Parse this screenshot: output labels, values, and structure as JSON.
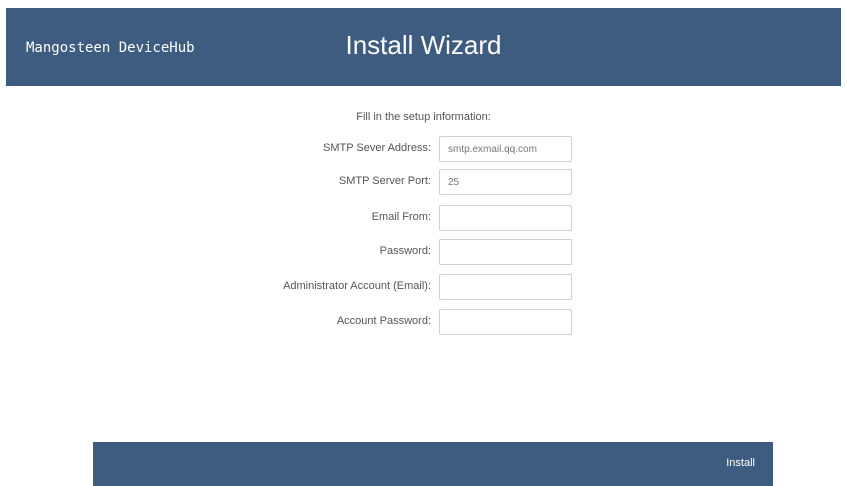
{
  "header": {
    "brand": "Mangosteen DeviceHub",
    "title": "Install Wizard"
  },
  "form": {
    "intro": "Fill in the setup information:",
    "fields": [
      {
        "label": "SMTP Sever Address:",
        "value": "smtp.exmail.qq.com"
      },
      {
        "label": "SMTP Server Port:",
        "value": "25"
      },
      {
        "label": "Email From:",
        "value": ""
      },
      {
        "label": "Password:",
        "value": ""
      },
      {
        "label": "Administrator Account (Email):",
        "value": ""
      },
      {
        "label": "Account Password:",
        "value": ""
      }
    ]
  },
  "footer": {
    "install_label": "Install"
  },
  "colors": {
    "header_bg": "#3e5b80",
    "footer_bg": "#3e5b80",
    "text": "#555555"
  }
}
